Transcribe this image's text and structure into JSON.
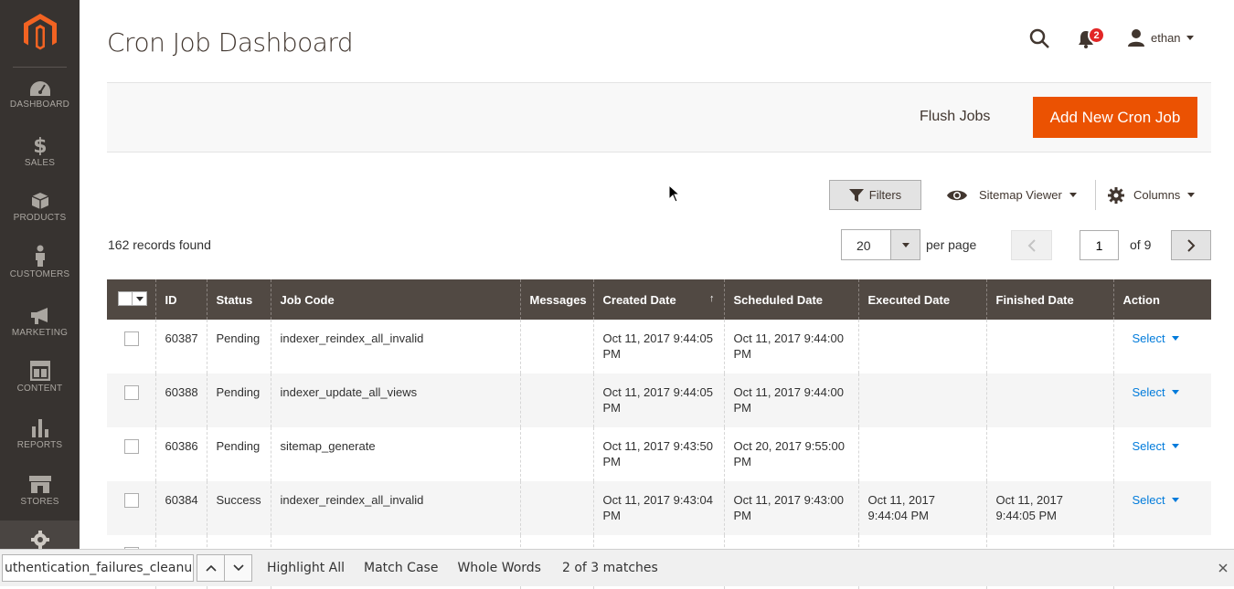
{
  "sidebar": {
    "items": [
      {
        "label": "DASHBOARD",
        "icon": "dashboard-icon"
      },
      {
        "label": "SALES",
        "icon": "dollar-icon"
      },
      {
        "label": "PRODUCTS",
        "icon": "cube-icon"
      },
      {
        "label": "CUSTOMERS",
        "icon": "person-icon"
      },
      {
        "label": "MARKETING",
        "icon": "megaphone-icon"
      },
      {
        "label": "CONTENT",
        "icon": "layout-icon"
      },
      {
        "label": "REPORTS",
        "icon": "bar-chart-icon"
      },
      {
        "label": "STORES",
        "icon": "store-icon"
      },
      {
        "label": "",
        "icon": "gear-icon"
      }
    ]
  },
  "header": {
    "title": "Cron Job Dashboard",
    "notification_count": "2",
    "username": "ethan"
  },
  "action_bar": {
    "flush_label": "Flush Jobs",
    "add_label": "Add New Cron Job"
  },
  "toolbar": {
    "filters_label": "Filters",
    "view_label": "Sitemap Viewer",
    "columns_label": "Columns",
    "records_found": "162 records found",
    "per_page_value": "20",
    "per_page_label": "per page",
    "current_page": "1",
    "page_total": "of 9"
  },
  "grid": {
    "columns": [
      "ID",
      "Status",
      "Job Code",
      "Messages",
      "Created Date",
      "Scheduled Date",
      "Executed Date",
      "Finished Date",
      "Action"
    ],
    "sort_indicator": "↑",
    "action_label": "Select",
    "rows": [
      {
        "id": "60387",
        "status": "Pending",
        "job_code": "indexer_reindex_all_invalid",
        "messages": "",
        "created": "Oct 11, 2017 9:44:05 PM",
        "scheduled": "Oct 11, 2017 9:44:00 PM",
        "executed": "",
        "finished": ""
      },
      {
        "id": "60388",
        "status": "Pending",
        "job_code": "indexer_update_all_views",
        "messages": "",
        "created": "Oct 11, 2017 9:44:05 PM",
        "scheduled": "Oct 11, 2017 9:44:00 PM",
        "executed": "",
        "finished": ""
      },
      {
        "id": "60386",
        "status": "Pending",
        "job_code": "sitemap_generate",
        "messages": "",
        "created": "Oct 11, 2017 9:43:50 PM",
        "scheduled": "Oct 20, 2017 9:55:00 PM",
        "executed": "",
        "finished": ""
      },
      {
        "id": "60384",
        "status": "Success",
        "job_code": "indexer_reindex_all_invalid",
        "messages": "",
        "created": "Oct 11, 2017 9:43:04 PM",
        "scheduled": "Oct 11, 2017 9:43:00 PM",
        "executed": "Oct 11, 2017 9:44:04 PM",
        "finished": "Oct 11, 2017 9:44:05 PM"
      }
    ]
  },
  "findbar": {
    "query": "uthentication_failures_cleanup",
    "highlight_all": "Highlight All",
    "match_case": "Match Case",
    "whole_words": "Whole Words",
    "status": "2 of 3 matches"
  },
  "colors": {
    "sidebar_bg": "#373330",
    "accent": "#eb5202",
    "grid_header": "#514943",
    "link": "#007bdb",
    "badge": "#e22626"
  }
}
